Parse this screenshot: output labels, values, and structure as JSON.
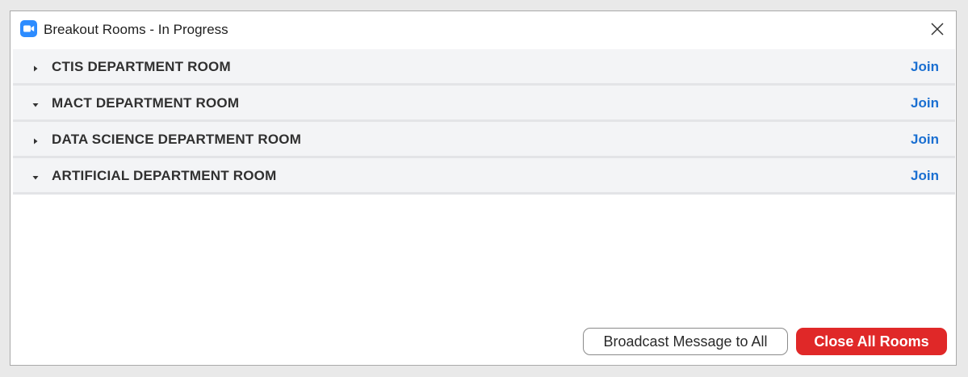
{
  "window": {
    "title": "Breakout Rooms - In Progress",
    "app_icon": "zoom-camera-icon",
    "close_icon": "close-icon"
  },
  "rooms": [
    {
      "name": "CTIS DEPARTMENT ROOM",
      "expanded": false,
      "join_label": "Join"
    },
    {
      "name": "MACT DEPARTMENT ROOM",
      "expanded": true,
      "join_label": "Join"
    },
    {
      "name": "DATA SCIENCE DEPARTMENT ROOM",
      "expanded": false,
      "join_label": "Join"
    },
    {
      "name": "ARTIFICIAL DEPARTMENT ROOM",
      "expanded": true,
      "join_label": "Join"
    }
  ],
  "footer": {
    "broadcast_label": "Broadcast Message to All",
    "close_all_label": "Close All Rooms"
  },
  "colors": {
    "accent_blue": "#1a6fd1",
    "zoom_blue": "#2d8cff",
    "danger_red": "#e02828"
  }
}
